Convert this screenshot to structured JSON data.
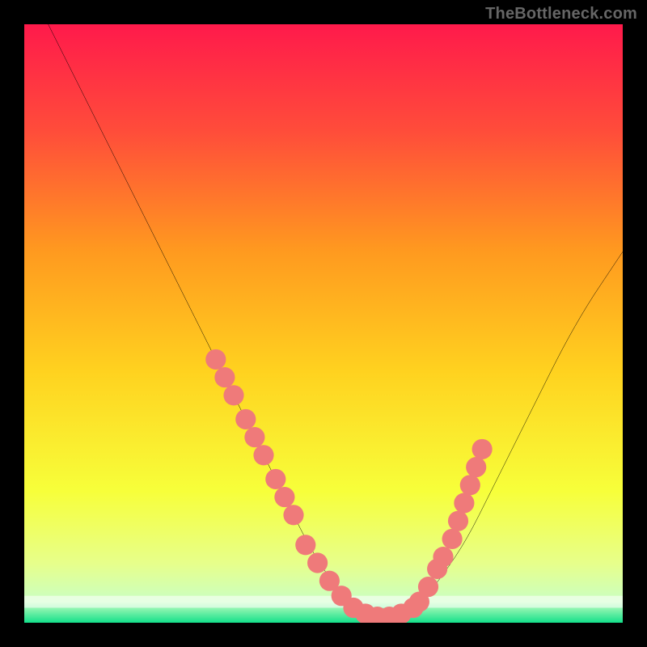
{
  "watermark": "TheBottleneck.com",
  "chart_data": {
    "type": "line",
    "title": "",
    "xlabel": "",
    "ylabel": "",
    "xlim": [
      0,
      100
    ],
    "ylim": [
      0,
      100
    ],
    "grid": false,
    "gradient_stops": [
      {
        "offset": 0,
        "color": "#ff1a4b"
      },
      {
        "offset": 0.18,
        "color": "#ff4d3a"
      },
      {
        "offset": 0.38,
        "color": "#ff9a1f"
      },
      {
        "offset": 0.58,
        "color": "#ffd21f"
      },
      {
        "offset": 0.78,
        "color": "#f7ff3a"
      },
      {
        "offset": 0.9,
        "color": "#e7ff8a"
      },
      {
        "offset": 0.965,
        "color": "#caffc2"
      },
      {
        "offset": 1.0,
        "color": "#13e08a"
      }
    ],
    "series": [
      {
        "name": "curve",
        "color": "#000000",
        "x": [
          4,
          8,
          12,
          16,
          20,
          24,
          28,
          32,
          36,
          40,
          44,
          48,
          52,
          56,
          60,
          62,
          66,
          70,
          74,
          78,
          82,
          86,
          90,
          94,
          98,
          100
        ],
        "y": [
          100,
          92,
          84,
          76,
          68,
          60,
          52,
          44,
          36,
          28,
          20,
          12,
          6,
          2,
          1,
          1,
          3,
          8,
          14,
          22,
          30,
          38,
          46,
          53,
          59,
          62
        ]
      }
    ],
    "markers": {
      "name": "beads",
      "color": "#ef7a7a",
      "radius": 1.7,
      "points": [
        {
          "x": 32,
          "y": 44
        },
        {
          "x": 33.5,
          "y": 41
        },
        {
          "x": 35,
          "y": 38
        },
        {
          "x": 37,
          "y": 34
        },
        {
          "x": 38.5,
          "y": 31
        },
        {
          "x": 40,
          "y": 28
        },
        {
          "x": 42,
          "y": 24
        },
        {
          "x": 43.5,
          "y": 21
        },
        {
          "x": 45,
          "y": 18
        },
        {
          "x": 47,
          "y": 13
        },
        {
          "x": 49,
          "y": 10
        },
        {
          "x": 51,
          "y": 7
        },
        {
          "x": 53,
          "y": 4.5
        },
        {
          "x": 55,
          "y": 2.5
        },
        {
          "x": 57,
          "y": 1.5
        },
        {
          "x": 59,
          "y": 1
        },
        {
          "x": 61,
          "y": 1
        },
        {
          "x": 63,
          "y": 1.5
        },
        {
          "x": 65,
          "y": 2.5
        },
        {
          "x": 66,
          "y": 3.5
        },
        {
          "x": 67.5,
          "y": 6
        },
        {
          "x": 69,
          "y": 9
        },
        {
          "x": 70,
          "y": 11
        },
        {
          "x": 71.5,
          "y": 14
        },
        {
          "x": 72.5,
          "y": 17
        },
        {
          "x": 73.5,
          "y": 20
        },
        {
          "x": 74.5,
          "y": 23
        },
        {
          "x": 75.5,
          "y": 26
        },
        {
          "x": 76.5,
          "y": 29
        }
      ]
    },
    "bottom_band": {
      "y": 3.5,
      "thickness": 2.0,
      "color": "#ffffff"
    }
  }
}
